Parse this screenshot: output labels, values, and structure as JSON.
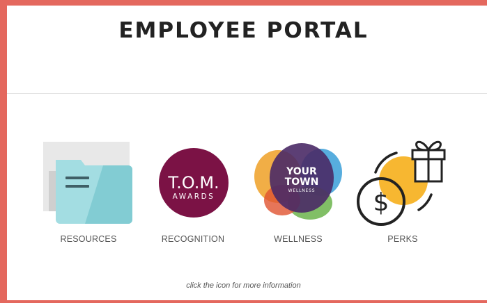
{
  "page": {
    "title": "EMPLOYEE PORTAL",
    "footer_note": "click the icon for more information"
  },
  "tiles": [
    {
      "label": "RESOURCES",
      "icon": "folder-icon"
    },
    {
      "label": "RECOGNITION",
      "icon": "tom-awards-logo",
      "logo_text": [
        "T.O.M.",
        "AWARDS"
      ]
    },
    {
      "label": "WELLNESS",
      "icon": "your-town-wellness-logo",
      "logo_text": [
        "YOUR",
        "TOWN",
        "WELLNESS"
      ]
    },
    {
      "label": "PERKS",
      "icon": "gift-coin-icon"
    }
  ],
  "colors": {
    "frame": "#e4685e",
    "folder": "#a3dde2",
    "tom_circle": "#7b1245",
    "perks_accent": "#f7b731"
  }
}
